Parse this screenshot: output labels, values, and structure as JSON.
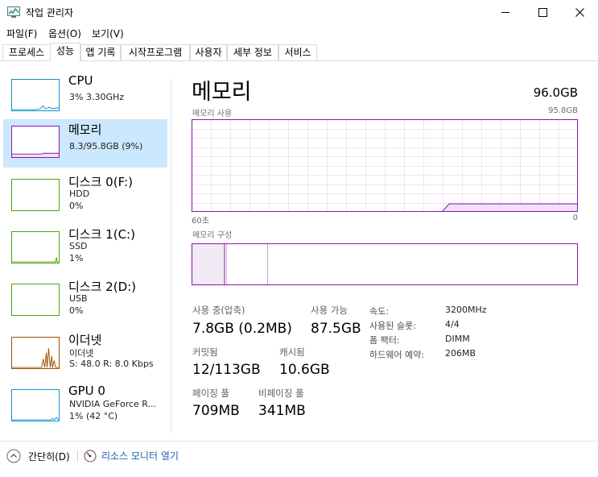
{
  "window": {
    "title": "작업 관리자"
  },
  "window_controls": {
    "minimize": "—",
    "maximize": "☐",
    "close": "✕"
  },
  "menu": {
    "items": [
      "파일(F)",
      "옵션(O)",
      "보기(V)"
    ]
  },
  "tabs": [
    "프로세스",
    "성능",
    "앱 기록",
    "시작프로그램",
    "사용자",
    "세부 정보",
    "서비스"
  ],
  "active_tab": "성능",
  "sidebar": {
    "items": [
      {
        "name": "CPU",
        "line1": "3% 3.30GHz",
        "line2": "",
        "color": "#1191c9"
      },
      {
        "name": "메모리",
        "line1": "8.3/95.8GB (9%)",
        "line2": "",
        "color": "#8b12ae"
      },
      {
        "name": "디스크 0(F:)",
        "line1": "HDD",
        "line2": "0%",
        "color": "#4da60c"
      },
      {
        "name": "디스크 1(C:)",
        "line1": "SSD",
        "line2": "1%",
        "color": "#4da60c"
      },
      {
        "name": "디스크 2(D:)",
        "line1": "USB",
        "line2": "0%",
        "color": "#4da60c"
      },
      {
        "name": "이더넷",
        "line1": "이더넷",
        "line2": "S: 48.0  R: 8.0 Kbps",
        "color": "#a74f01"
      },
      {
        "name": "GPU 0",
        "line1": "NVIDIA GeForce R...",
        "line2": "1% (42 °C)",
        "color": "#1191c9"
      }
    ]
  },
  "main": {
    "title": "메모리",
    "total": "96.0GB",
    "usage_label": "메모리 사용",
    "usage_max": "95.8GB",
    "axis_left": "60초",
    "axis_right": "0",
    "composition_label": "메모리 구성",
    "usage_fraction": 0.087,
    "stats": {
      "in_use_label": "사용 중(압축)",
      "in_use_value": "7.8GB (0.2MB)",
      "available_label": "사용 가능",
      "available_value": "87.5GB",
      "committed_label": "커밋됨",
      "committed_value": "12/113GB",
      "cached_label": "캐시됨",
      "cached_value": "10.6GB",
      "paged_label": "페이징 풀",
      "paged_value": "709MB",
      "nonpaged_label": "비페이징 풀",
      "nonpaged_value": "341MB"
    },
    "details": [
      {
        "key": "속도:",
        "value": "3200MHz"
      },
      {
        "key": "사용된 슬롯:",
        "value": "4/4"
      },
      {
        "key": "폼 팩터:",
        "value": "DIMM"
      },
      {
        "key": "하드웨어 예약:",
        "value": "206MB"
      }
    ]
  },
  "bottom": {
    "fewer_details": "간단히(D)",
    "resource_monitor": "리소스 모니터 열기"
  },
  "colors": {
    "memory": "#8b12ae",
    "link": "#1a5fb4",
    "selected": "#cce8ff"
  }
}
